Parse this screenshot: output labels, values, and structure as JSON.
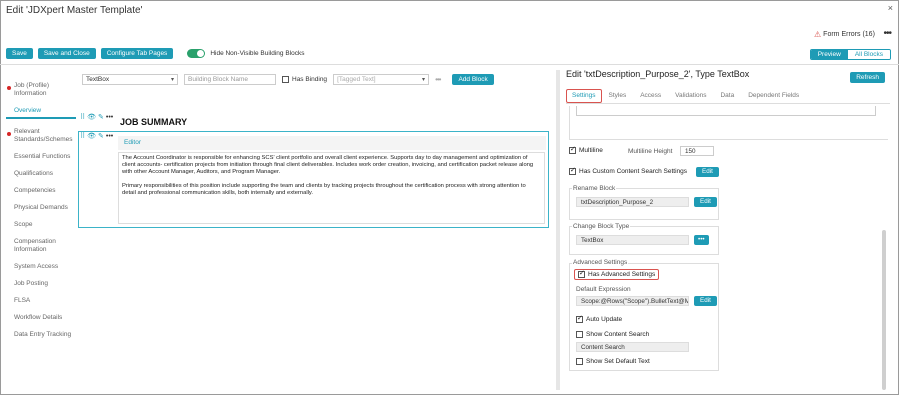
{
  "window": {
    "title": "Edit 'JDXpert Master Template'",
    "close_glyph": "×"
  },
  "header": {
    "form_errors": "Form Errors (16)",
    "more_glyph": "•••"
  },
  "toolbar": {
    "save": "Save",
    "save_close": "Save and Close",
    "configure_tabs": "Configure Tab Pages",
    "hide_toggle_label": "Hide Non-Visible Building Blocks",
    "preview": "Preview",
    "all_blocks": "All Blocks"
  },
  "sidebar": {
    "items": [
      {
        "label": "Job (Profile) Information",
        "error": true
      },
      {
        "label": "Overview",
        "active": true
      },
      {
        "label": "Relevant Standards/Schemes",
        "error": true
      },
      {
        "label": "Essential Functions"
      },
      {
        "label": "Qualifications"
      },
      {
        "label": "Competencies"
      },
      {
        "label": "Physical Demands"
      },
      {
        "label": "Scope"
      },
      {
        "label": "Compensation Information"
      },
      {
        "label": "System Access"
      },
      {
        "label": "Job Posting"
      },
      {
        "label": "FLSA"
      },
      {
        "label": "Workflow Details"
      },
      {
        "label": "Data Entry Tracking"
      }
    ]
  },
  "add_block_row": {
    "block_type": "TextBox",
    "name_placeholder": "Building Block Name",
    "has_binding": "Has Binding",
    "tagged_text": "[Tagged Text]",
    "more": "•••",
    "add_block": "Add Block"
  },
  "canvas": {
    "section_heading": "JOB SUMMARY",
    "editor_label": "Editor",
    "paragraph_1": "The Account Coordinator is responsible for enhancing SCS' client portfolio and overall client experience. Supports day to day management and optimization of client accounts- certification projects from initiation through final client deliverables.  Includes work order creation, invoicing, and certification packet release along with other Account Manager, Auditors, and Program Manager.",
    "paragraph_2": "Primary responsibilities of this position include supporting the team and clients by tracking projects throughout the certification process with strong attention to detail and professional communication skills, both internally and externally."
  },
  "panel": {
    "title": "Edit 'txtDescription_Purpose_2', Type TextBox",
    "refresh": "Refresh",
    "tabs": [
      "Settings",
      "Styles",
      "Access",
      "Validations",
      "Data",
      "Dependent Fields"
    ],
    "active_tab": "Settings",
    "multiline": "Multiline",
    "multiline_height_label": "Multiline Height",
    "multiline_height": "150",
    "custom_search": "Has Custom Content Search Settings",
    "edit": "Edit",
    "rename_block": "Rename Block",
    "block_name": "txtDescription_Purpose_2",
    "change_block_type": "Change Block Type",
    "block_type": "TextBox",
    "more": "•••",
    "advanced_settings": "Advanced Settings",
    "has_advanced": "Has Advanced Settings",
    "default_expression_label": "Default Expression",
    "default_expression": "Scope:@Rows(\"Scope\").BulletText@M",
    "auto_update": "Auto Update",
    "show_content_search": "Show Content Search",
    "content_search": "Content Search",
    "show_set_default": "Show Set Default Text"
  },
  "colors": {
    "accent": "#1e9bb5",
    "error": "#d9534f",
    "toggle_on": "#2aa16c"
  }
}
